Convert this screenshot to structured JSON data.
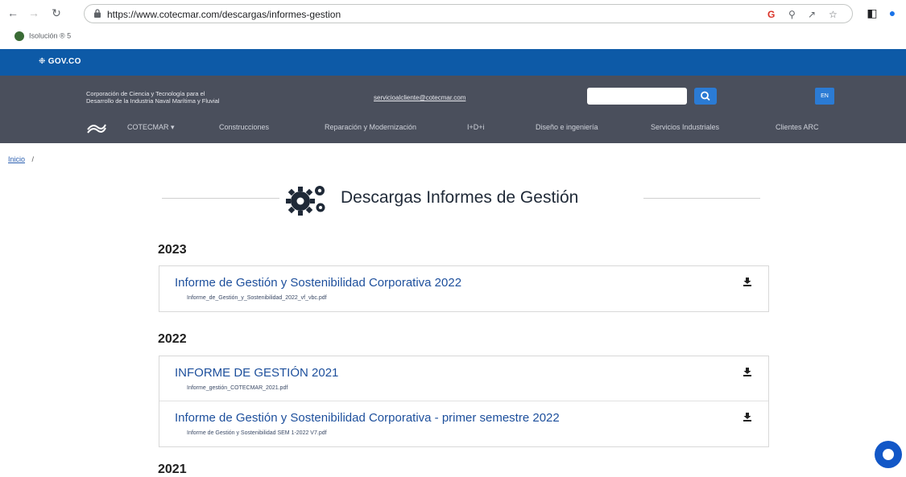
{
  "browser": {
    "url": "https://www.cotecmar.com/descargas/informes-gestion",
    "bookmark": "Isolución ® 5"
  },
  "gov": {
    "logo": "❉ GOV.CO"
  },
  "header": {
    "corp_line1": "Corporación de Ciencia y Tecnología para el",
    "corp_line2": "Desarrollo de la Industria Naval Marítima y Fluvial",
    "email": "servicioalcliente@cotecmar.com",
    "search_placeholder": "",
    "lang": "EN",
    "menu": [
      "COTECMAR ▾",
      "Construcciones",
      "Reparación y Modernización",
      "I+D+i",
      "Diseño e ingeniería",
      "Servicios Industriales",
      "Clientes ARC"
    ]
  },
  "breadcrumb": {
    "home": "Inicio",
    "sep": "/"
  },
  "page": {
    "title": "Descargas Informes de Gestión"
  },
  "sections": [
    {
      "year": "2023",
      "items": [
        {
          "title": "Informe de Gestión y Sostenibilidad Corporativa 2022",
          "file": "Informe_de_Gestión_y_Sostenibilidad_2022_vf_vbc.pdf"
        }
      ]
    },
    {
      "year": "2022",
      "items": [
        {
          "title": "INFORME DE GESTIÓN 2021",
          "file": "Informe_gestión_COTECMAR_2021.pdf"
        },
        {
          "title": "Informe de Gestión y Sostenibilidad Corporativa - primer semestre 2022",
          "file": "Informe de Gestión y Sostenibilidad SEM 1-2022 V7.pdf"
        }
      ]
    },
    {
      "year": "2021",
      "items": []
    }
  ],
  "colors": {
    "gov_blue": "#0d5aa7",
    "header_bg": "#4a4f5c",
    "link": "#1d4f9c",
    "button_blue": "#2b7bd4"
  }
}
